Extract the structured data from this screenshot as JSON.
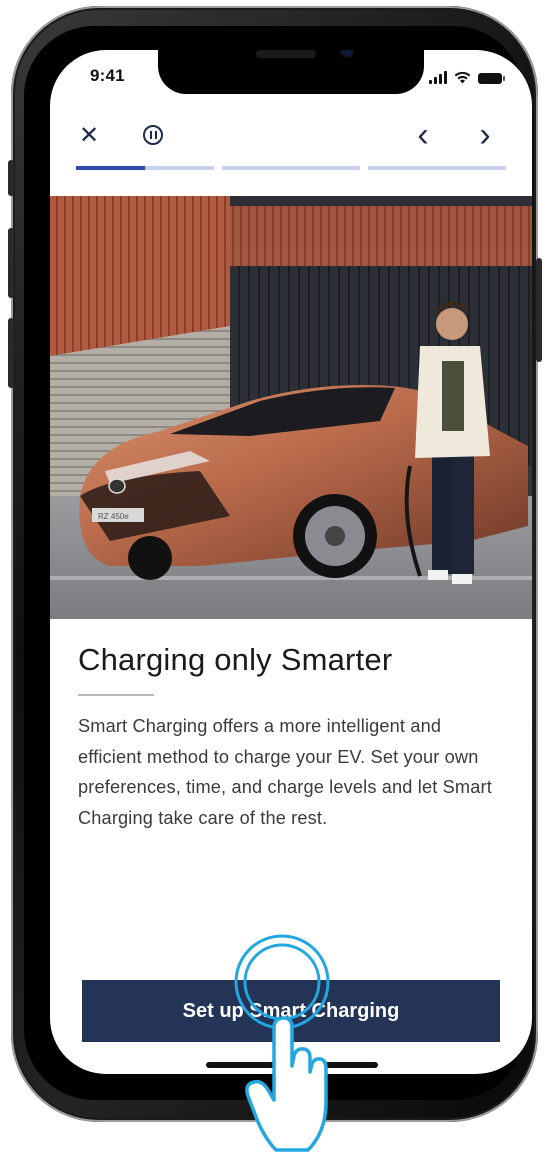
{
  "status_bar": {
    "time": "9:41"
  },
  "controls": {
    "close_icon": "close-icon",
    "pause_icon": "pause-icon",
    "prev_icon": "chevron-left-icon",
    "next_icon": "chevron-right-icon",
    "close_glyph": "✕",
    "prev_glyph": "‹",
    "next_glyph": "›"
  },
  "story_progress": {
    "segments": 3,
    "current_segment": 1,
    "current_segment_progress": 0.5
  },
  "content": {
    "title": "Charging only Smarter",
    "body": "Smart Charging offers a more intelligent and efficient method to charge your EV. Set your own preferences, time, and charge levels and let Smart Charging take care of the rest.",
    "plate_text": "RZ 450e"
  },
  "cta": {
    "label": "Set up Smart Charging"
  },
  "colors": {
    "accent": "#2c4aa6",
    "button": "#233456",
    "progress_track": "#c9d0ec"
  }
}
